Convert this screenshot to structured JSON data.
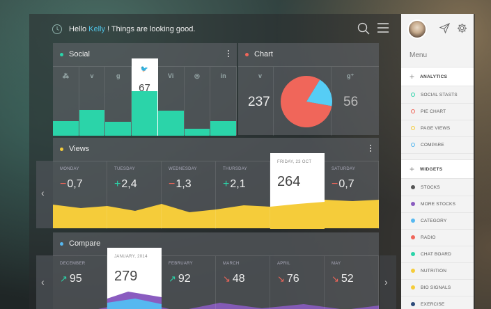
{
  "header": {
    "greeting_prefix": "Hello",
    "user_name": "Kelly",
    "greeting_suffix": "! Things are looking good."
  },
  "social": {
    "title": "Social",
    "dot_color": "#2bd4a9",
    "columns": [
      {
        "icon": "dropbox-icon",
        "glyph": "⁂",
        "level": 0.21
      },
      {
        "icon": "vimeo-icon",
        "glyph": "v",
        "level": 0.37
      },
      {
        "icon": "google-plus-icon",
        "glyph": "g",
        "level": 0.2
      },
      {
        "icon": "twitter-icon",
        "glyph": "🐦",
        "level": 0.65,
        "value": "67",
        "active": true
      },
      {
        "icon": "vine-icon",
        "glyph": "Vi",
        "level": 0.36
      },
      {
        "icon": "pinterest-icon",
        "glyph": "◎",
        "level": 0.1
      },
      {
        "icon": "linkedin-icon",
        "glyph": "in",
        "level": 0.21
      }
    ]
  },
  "chart": {
    "title": "Chart",
    "dot_color": "#f0665a",
    "left_icon": "vimeo-icon",
    "left_value": "237",
    "right_icon": "google-plus-icon",
    "right_value": "56",
    "pie_colors": [
      "#f0665a",
      "#56cdf5"
    ],
    "pie_share": [
      0.81,
      0.19
    ]
  },
  "views": {
    "title": "Views",
    "dot_color": "#f5cc3a",
    "area_color": "#f5cc3a",
    "days": [
      {
        "day": "MONDAY",
        "sign": "−",
        "sign_color": "#f0665a",
        "value": "0,7"
      },
      {
        "day": "TUESDAY",
        "sign": "+",
        "sign_color": "#2bd4a9",
        "value": "2,4"
      },
      {
        "day": "WEDNESDAY",
        "sign": "−",
        "sign_color": "#f0665a",
        "value": "1,3"
      },
      {
        "day": "THURSDAY",
        "sign": "+",
        "sign_color": "#2bd4a9",
        "value": "2,1"
      },
      {
        "day": "FRIDAY, 23 OCT",
        "sign": "",
        "sign_color": "#444",
        "value": "264",
        "active": true
      },
      {
        "day": "SATURDAY",
        "sign": "−",
        "sign_color": "#f0665a",
        "value": "0,7"
      }
    ]
  },
  "compare": {
    "title": "Compare",
    "dot_color": "#56b8f0",
    "months": [
      {
        "month": "DECEMBER",
        "arrow": "↗",
        "arrow_color": "#2bd4a9",
        "value": "95"
      },
      {
        "month": "JANUARY, 2014",
        "arrow": "",
        "arrow_color": "#444",
        "value": "279",
        "active": true
      },
      {
        "month": "FEBRUARY",
        "arrow": "↗",
        "arrow_color": "#2bd4a9",
        "value": "92"
      },
      {
        "month": "MARCH",
        "arrow": "↘",
        "arrow_color": "#f0665a",
        "value": "48"
      },
      {
        "month": "APRIL",
        "arrow": "↘",
        "arrow_color": "#f0665a",
        "value": "76"
      },
      {
        "month": "MAY",
        "arrow": "↘",
        "arrow_color": "#f0665a",
        "value": "52"
      }
    ]
  },
  "sidebar": {
    "menu_title": "Menu",
    "analytics_label": "ANALYTICS",
    "analytics_items": [
      {
        "label": "SOCIAL STASTS",
        "color": "#2bd4a9",
        "ring": true
      },
      {
        "label": "PIE CHART",
        "color": "#f0665a",
        "ring": true
      },
      {
        "label": "PAGE VIEWS",
        "color": "#f5cc3a",
        "ring": true
      },
      {
        "label": "COMPARE",
        "color": "#56b8f0",
        "ring": true
      }
    ],
    "widgets_label": "WIDGETS",
    "widgets_items": [
      {
        "label": "STOCKS",
        "color": "#555555",
        "ring": false
      },
      {
        "label": "MORE STOCKS",
        "color": "#8a5cc0",
        "ring": false
      },
      {
        "label": "CATEGORY",
        "color": "#56b8f0",
        "ring": false
      },
      {
        "label": "RADIO",
        "color": "#f0665a",
        "ring": false
      },
      {
        "label": "CHAT BOARD",
        "color": "#2bd4a9",
        "ring": false
      },
      {
        "label": "NUTRITION",
        "color": "#f5cc3a",
        "ring": false
      },
      {
        "label": "BIO SIGNALS",
        "color": "#f5cc3a",
        "ring": false
      },
      {
        "label": "EXERCISE",
        "color": "#2d4b7a",
        "ring": false
      }
    ]
  }
}
